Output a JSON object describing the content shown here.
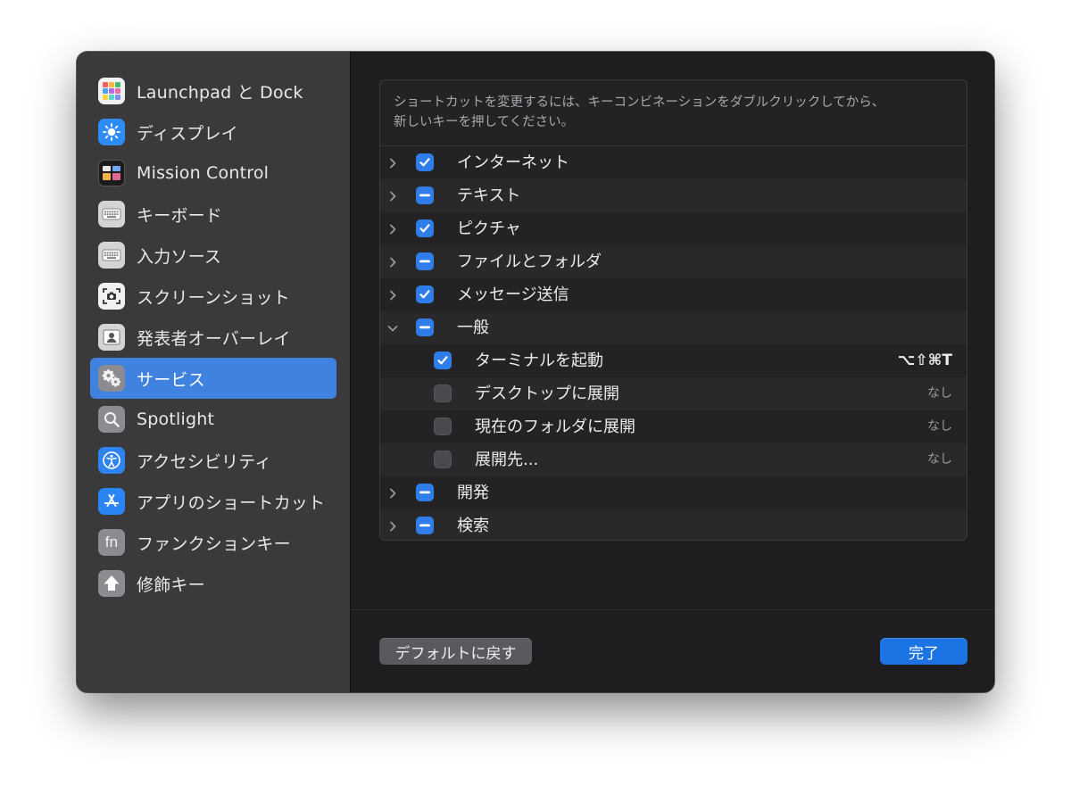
{
  "sidebar": {
    "items": [
      {
        "label": "Launchpad と Dock",
        "icon": "launchpad-icon"
      },
      {
        "label": "ディスプレイ",
        "icon": "display-icon"
      },
      {
        "label": "Mission Control",
        "icon": "mission-control-icon"
      },
      {
        "label": "キーボード",
        "icon": "keyboard-icon"
      },
      {
        "label": "入力ソース",
        "icon": "keyboard-icon"
      },
      {
        "label": "スクリーンショット",
        "icon": "screenshot-icon"
      },
      {
        "label": "発表者オーバーレイ",
        "icon": "presenter-overlay-icon"
      },
      {
        "label": "サービス",
        "icon": "gears-icon",
        "selected": true
      },
      {
        "label": "Spotlight",
        "icon": "magnifier-icon"
      },
      {
        "label": "アクセシビリティ",
        "icon": "accessibility-icon"
      },
      {
        "label": "アプリのショートカット",
        "icon": "app-store-icon"
      },
      {
        "label": "ファンクションキー",
        "icon": "fn-icon",
        "icon_text": "fn"
      },
      {
        "label": "修飾キー",
        "icon": "up-arrow-icon"
      }
    ]
  },
  "main": {
    "instructions_line1": "ショートカットを変更するには、キーコンビネーションをダブルクリックしてから、",
    "instructions_line2": "新しいキーを押してください。",
    "rows": [
      {
        "label": "インターネット",
        "state": "checked",
        "expand": "collapsed"
      },
      {
        "label": "テキスト",
        "state": "mixed",
        "expand": "collapsed"
      },
      {
        "label": "ピクチャ",
        "state": "checked",
        "expand": "collapsed"
      },
      {
        "label": "ファイルとフォルダ",
        "state": "mixed",
        "expand": "collapsed"
      },
      {
        "label": "メッセージ送信",
        "state": "checked",
        "expand": "collapsed"
      },
      {
        "label": "一般",
        "state": "mixed",
        "expand": "expanded"
      },
      {
        "label": "ターミナルを起動",
        "state": "checked",
        "child": true,
        "shortcut": "⌥⇧⌘T"
      },
      {
        "label": "デスクトップに展開",
        "state": "unchecked",
        "child": true,
        "shortcut": "なし",
        "shortcut_none": true
      },
      {
        "label": "現在のフォルダに展開",
        "state": "unchecked",
        "child": true,
        "shortcut": "なし",
        "shortcut_none": true
      },
      {
        "label": "展開先...",
        "state": "unchecked",
        "child": true,
        "shortcut": "なし",
        "shortcut_none": true
      },
      {
        "label": "開発",
        "state": "mixed",
        "expand": "collapsed"
      },
      {
        "label": "検索",
        "state": "mixed",
        "expand": "collapsed"
      }
    ],
    "restore_defaults_label": "デフォルトに戻す",
    "done_label": "完了"
  },
  "colors": {
    "accent": "#2e7de9",
    "sidebar_selected": "#3f82e0",
    "sidebar_bg": "#3a3a3d",
    "content_bg": "#1e1e21"
  }
}
